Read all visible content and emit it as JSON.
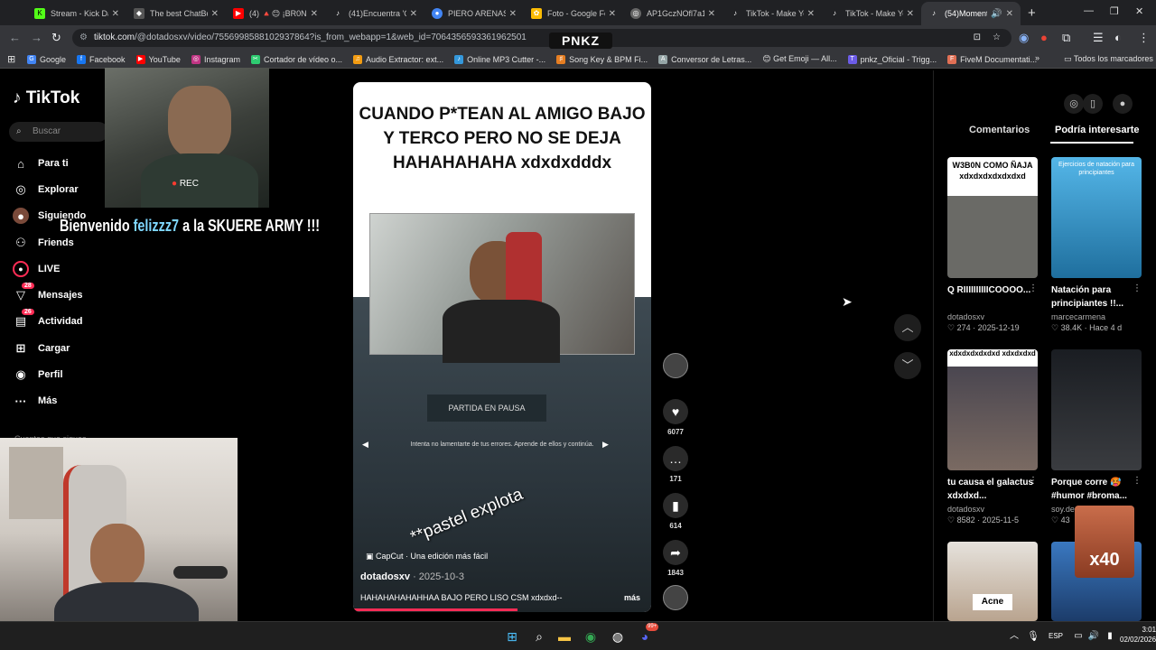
{
  "browser": {
    "tabs": [
      {
        "title": "Stream - Kick Da",
        "icon": "kick-icon",
        "color": "#53fc18",
        "active": false
      },
      {
        "title": "The best ChatBot",
        "icon": "chatbot-icon",
        "color": "#888888",
        "active": false
      },
      {
        "title": "(4) 🔺😊 ¡BR0NC",
        "icon": "youtube-icon",
        "color": "#ff0000",
        "active": false
      },
      {
        "title": "(41)Encuentra 'O.",
        "icon": "tiktok-icon",
        "color": "#000000",
        "active": false
      },
      {
        "title": "PIERO ARENAS - ",
        "icon": "chrome-icon",
        "color": "#4285f4",
        "active": false
      },
      {
        "title": "Foto - Google Fot",
        "icon": "photos-icon",
        "color": "#fbbc04",
        "active": false
      },
      {
        "title": "AP1GczNOfl7a15",
        "icon": "globe-icon",
        "color": "#666666",
        "active": false
      },
      {
        "title": "TikTok - Make You",
        "icon": "tiktok-icon",
        "color": "#000000",
        "active": false
      },
      {
        "title": "TikTok - Make You",
        "icon": "tiktok-icon",
        "color": "#000000",
        "active": false
      },
      {
        "title": "(54)Momento",
        "icon": "tiktok-icon",
        "color": "#000000",
        "active": true
      }
    ],
    "url_host": "tiktok.com",
    "url_path": "/@dotadosxv/video/7556998588102937864?is_from_webapp=1&web_id=7064356593361962501",
    "overlay_logo": "PNKZ",
    "bookmarks": [
      {
        "label": "Google",
        "color": "#4285f4"
      },
      {
        "label": "Facebook",
        "color": "#1877f2"
      },
      {
        "label": "YouTube",
        "color": "#ff0000"
      },
      {
        "label": "Instagram",
        "color": "#c13584"
      },
      {
        "label": "Cortador de vídeo o...",
        "color": "#2ecc71"
      },
      {
        "label": "Audio Extractor: ext...",
        "color": "#f39c12"
      },
      {
        "label": "Online MP3 Cutter -...",
        "color": "#3498db"
      },
      {
        "label": "Song Key & BPM Fi...",
        "color": "#e67e22"
      },
      {
        "label": "Conversor de Letras...",
        "color": "#95a5a6"
      },
      {
        "label": "😊 Get Emoji — All...",
        "color": "#f1c40f"
      },
      {
        "label": "pnkz_Oficial - Trigg...",
        "color": "#6c5ce7"
      },
      {
        "label": "FiveM Documentati...",
        "color": "#e17055"
      }
    ],
    "all_bookmarks": "Todos los marcadores"
  },
  "tiktok": {
    "logo": "TikTok",
    "search_placeholder": "Buscar",
    "nav": [
      {
        "label": "Para ti",
        "icon": "home-icon"
      },
      {
        "label": "Explorar",
        "icon": "compass-icon"
      },
      {
        "label": "Siguiendo",
        "icon": "following-icon"
      },
      {
        "label": "Friends",
        "icon": "friends-icon"
      },
      {
        "label": "LIVE",
        "icon": "live-icon"
      },
      {
        "label": "Mensajes",
        "icon": "messages-icon",
        "badge": "28"
      },
      {
        "label": "Actividad",
        "icon": "activity-icon",
        "badge": "26"
      },
      {
        "label": "Cargar",
        "icon": "upload-icon"
      },
      {
        "label": "Perfil",
        "icon": "profile-icon"
      },
      {
        "label": "Más",
        "icon": "more-icon"
      }
    ],
    "following_heading": "Cuentas que sigues"
  },
  "stream_overlay": {
    "welcome_prefix": "Bienvenido",
    "welcome_name": "felizzz7",
    "welcome_suffix": "a la SKUERE ARMY !!!",
    "rec_label": "REC"
  },
  "video": {
    "caption": "CUANDO P*TEAN AL AMIGO BAJO Y TERCO PERO NO SE DEJA HAHAHAHAHA xdxdxdddx",
    "pause_label": "PARTIDA EN PAUSA",
    "tip": "Intenta no lamentarte de tus errores. Aprende de ellos y continúa.",
    "overlay_text": "**pastel explota",
    "capcut": "CapCut · Una edición más fácil",
    "author": "dotadosxv",
    "date": "· 2025-10-3",
    "description": "HAHAHAHAHAHHAA BAJO PERO LISO CSM xdxdxd--",
    "more": "más",
    "likes": "6077",
    "comments": "171",
    "saves": "614",
    "shares": "1843",
    "progress_fraction": 0.55
  },
  "panel": {
    "tab_comments": "Comentarios",
    "tab_interest": "Podría interesarte",
    "cards": [
      {
        "thumb_text": "W3B0N COMO ÑAJA xdxdxdxdxdxdxd",
        "title": "Q RIIIIIIIIIICOOOO...",
        "author": "dotadosxv",
        "likes": "274",
        "date": "2025-12-19",
        "bg": "#5a5a5a"
      },
      {
        "thumb_text": "Ejercicios de natación para principiantes",
        "title": "Natación para principiantes !!...",
        "author": "marcecarmena",
        "likes": "38.4K",
        "date": "Hace 4 d",
        "bg": "#2f8fc2"
      },
      {
        "thumb_text": "xdxdxdxdxdxd xdxdxdxd",
        "title": "tu causa el galactus xdxdxd...",
        "author": "dotadosxv",
        "likes": "8582",
        "date": "2025-11-5",
        "bg": "#3b3a44"
      },
      {
        "thumb_text": "",
        "title": "Porque corre 🥵 #humor #broma...",
        "author": "soy.de",
        "likes": "43",
        "date": "",
        "bg": "#1c1f24"
      },
      {
        "thumb_text": "Acne",
        "title": "",
        "author": "",
        "likes": "",
        "date": "",
        "bg": "#bfae9e"
      },
      {
        "thumb_text": "",
        "title": "",
        "author": "",
        "likes": "",
        "date": "",
        "bg": "#2a5a9a"
      }
    ]
  },
  "stream_stamp": "x40",
  "taskbar": {
    "lang": "ESP",
    "time": "3:01",
    "date": "02/02/2026",
    "discord_badge": "99+"
  }
}
